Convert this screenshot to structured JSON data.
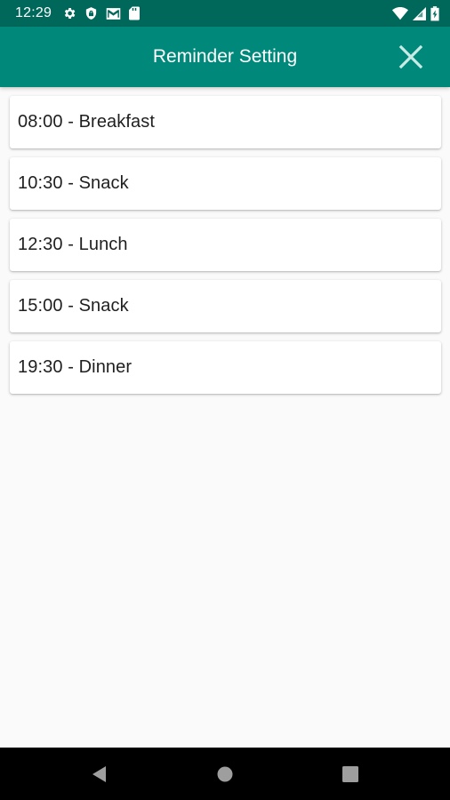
{
  "status_bar": {
    "time": "12:29",
    "left_icons": [
      "gear-icon",
      "shield-icon",
      "mail-icon",
      "sd-card-icon"
    ],
    "right_icons": [
      "wifi-icon",
      "signal-icon",
      "battery-icon"
    ],
    "background": "#00675b"
  },
  "app_bar": {
    "title": "Reminder Setting",
    "close_icon": "close-icon",
    "background": "#00897b"
  },
  "reminders": [
    {
      "label": "08:00 - Breakfast"
    },
    {
      "label": "10:30 - Snack"
    },
    {
      "label": "12:30 - Lunch"
    },
    {
      "label": "15:00 - Snack"
    },
    {
      "label": "19:30 - Dinner"
    }
  ],
  "nav_bar": {
    "buttons": [
      "back-icon",
      "home-icon",
      "recents-icon"
    ],
    "background": "#000000"
  }
}
